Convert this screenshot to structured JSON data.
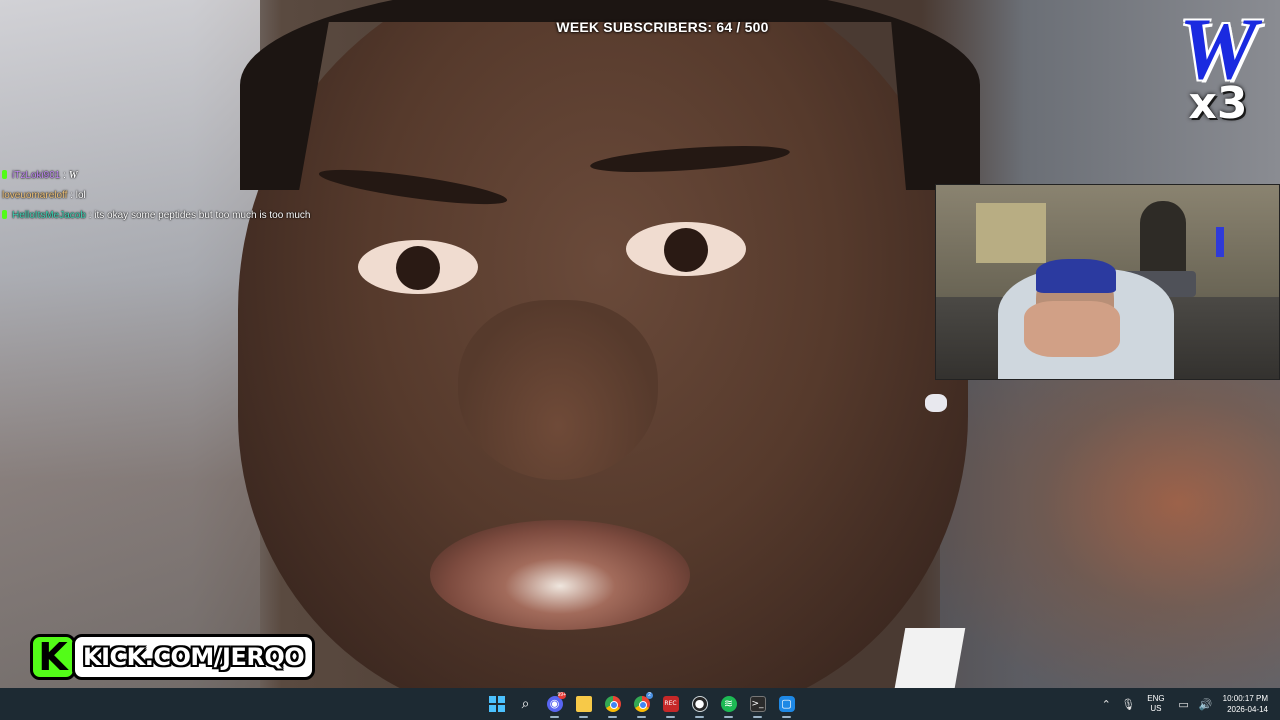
{
  "overlay": {
    "week_subscribers": "WEEK SUBSCRIBERS: 64 / 500",
    "logo_letter": "W",
    "logo_multiplier": "x3"
  },
  "chat": [
    {
      "user": "iTzLoki901",
      "separator": ":",
      "message": "W",
      "emote": true,
      "badge": true
    },
    {
      "user": "loveuomareloff",
      "separator": ":",
      "message": "lol",
      "emote": false,
      "badge": false
    },
    {
      "user": "HelloItsMeJacob",
      "separator": ":",
      "message": "its okay some peptides but too much is too much",
      "emote": false,
      "badge": true
    }
  ],
  "kick_banner": {
    "icon_letter": "K",
    "text": "KICK.COM/JERQO"
  },
  "taskbar": {
    "apps": [
      {
        "name": "start",
        "icon": "windows-icon"
      },
      {
        "name": "search",
        "icon": "search-icon",
        "glyph": "⌕"
      },
      {
        "name": "discord",
        "icon": "discord-icon",
        "glyph": "◉",
        "badge": "99+"
      },
      {
        "name": "file-explorer",
        "icon": "folder-icon"
      },
      {
        "name": "chrome",
        "icon": "chrome-icon"
      },
      {
        "name": "chrome-2",
        "icon": "chrome-icon",
        "badge": "2"
      },
      {
        "name": "recorder",
        "icon": "rec-icon",
        "glyph": "REC"
      },
      {
        "name": "obs",
        "icon": "obs-icon",
        "glyph": "●"
      },
      {
        "name": "spotify",
        "icon": "spotify-icon",
        "glyph": "≋"
      },
      {
        "name": "terminal",
        "icon": "terminal-icon",
        "glyph": ">_"
      },
      {
        "name": "app",
        "icon": "app-icon",
        "glyph": "▢"
      }
    ],
    "tray": {
      "lang_line1": "ENG",
      "lang_line2": "US",
      "time": "10:00:17 PM",
      "date": "2026-04-14"
    }
  },
  "colors": {
    "kick_green": "#53fc18",
    "logo_blue": "#1a2ae0",
    "taskbar_bg": "#1d2a33"
  }
}
